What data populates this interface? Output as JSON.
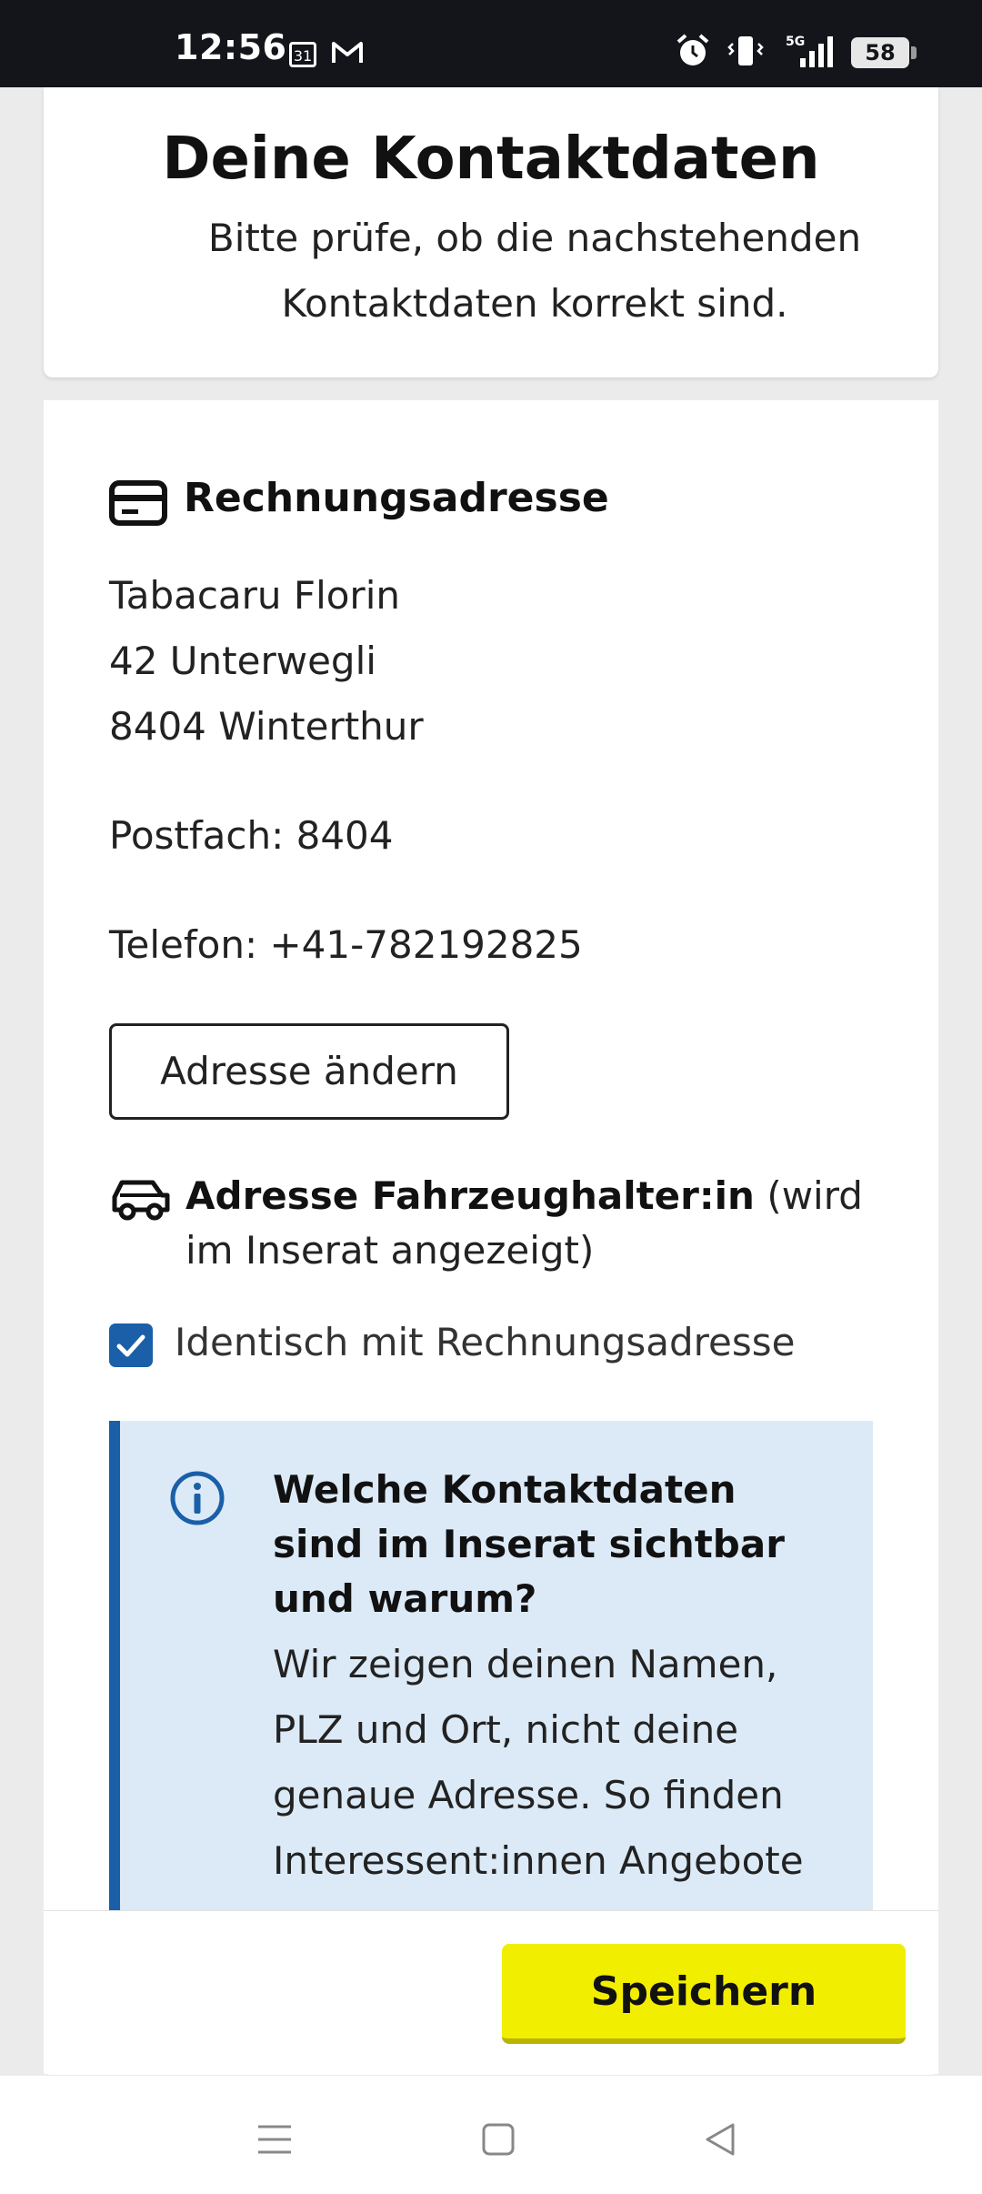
{
  "status_bar": {
    "time": "12:56",
    "calendar_day": "31",
    "network": "5G",
    "battery": "58"
  },
  "header": {
    "title": "Deine Kontaktdaten",
    "subtitle": "Bitte prüfe, ob die nachstehenden Kontaktdaten korrekt sind."
  },
  "billing": {
    "title": "Rechnungsadresse",
    "name": "Tabacaru Florin",
    "street": "42 Unterwegli",
    "city": "8404 Winterthur",
    "postbox": "Postfach: 8404",
    "phone": "Telefon: +41-782192825",
    "change_button": "Adresse ändern"
  },
  "holder": {
    "title": "Adresse Fahrzeughalter:in",
    "note": " (wird im Inserat angezeigt)",
    "checkbox_label": "Identisch mit Rechnungsadresse",
    "checkbox_checked": true
  },
  "info": {
    "title": "Welche Kontaktdaten sind im Inserat sichtbar und warum?",
    "body": "Wir zeigen deinen Namen, PLZ und Ort, nicht deine genaue Adresse. So finden Interessent:innen Angebote"
  },
  "footer": {
    "save_button": "Speichern"
  },
  "colors": {
    "accent_blue": "#1a5fa8",
    "info_bg": "#dceaf7",
    "save_yellow": "#f2ee00"
  }
}
